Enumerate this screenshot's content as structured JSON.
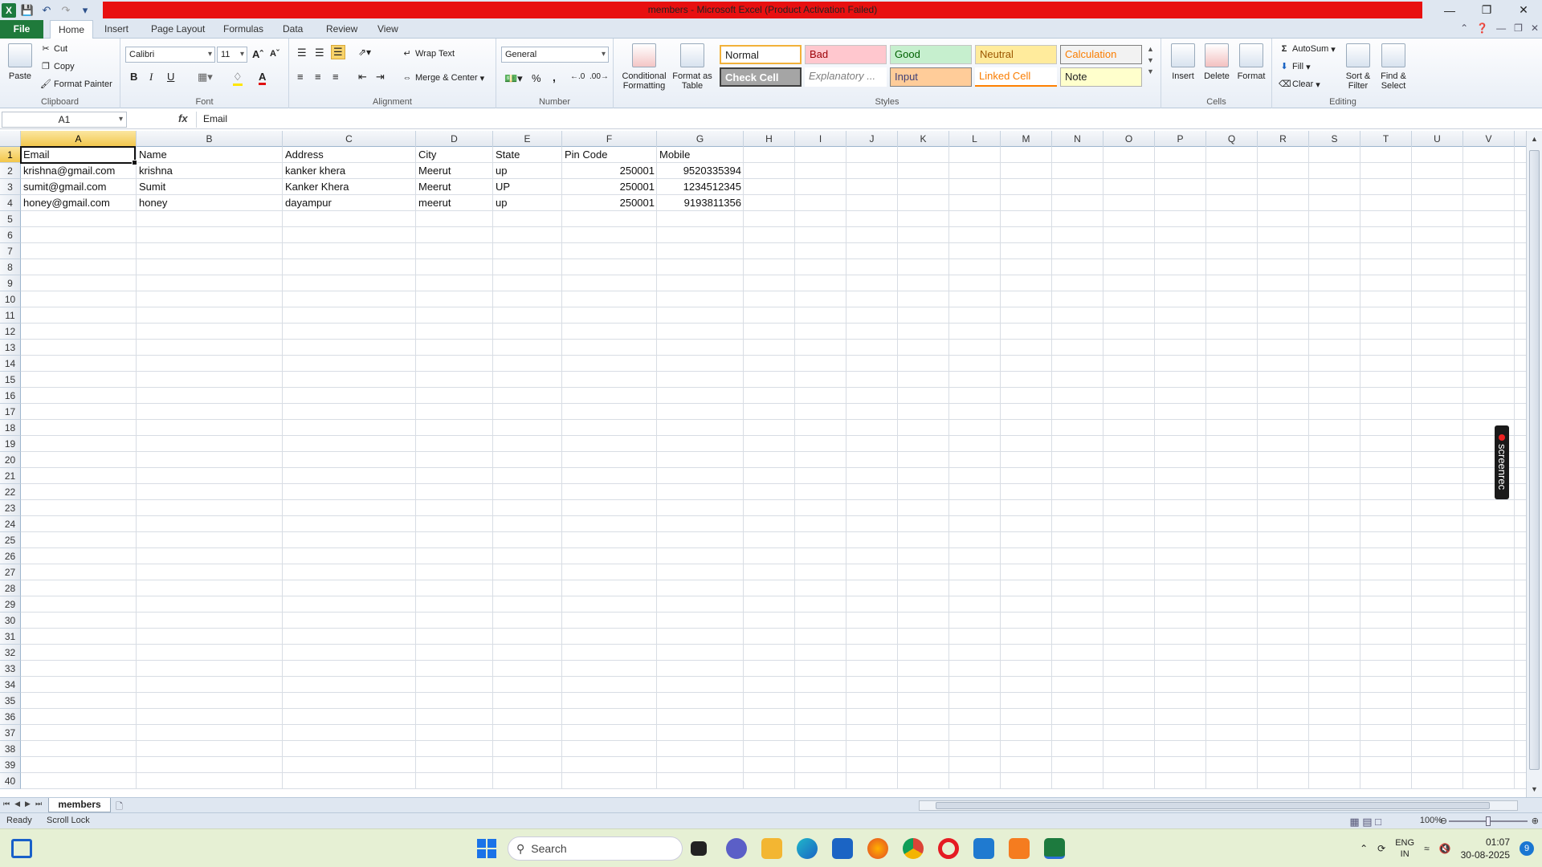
{
  "window": {
    "title": "members - Microsoft Excel (Product Activation Failed)"
  },
  "tabs": {
    "file": "File",
    "home": "Home",
    "insert": "Insert",
    "page_layout": "Page Layout",
    "formulas": "Formulas",
    "data": "Data",
    "review": "Review",
    "view": "View"
  },
  "ribbon": {
    "clipboard": {
      "label": "Clipboard",
      "paste": "Paste",
      "cut": "Cut",
      "copy": "Copy",
      "format_painter": "Format Painter"
    },
    "font": {
      "label": "Font",
      "name": "Calibri",
      "size": "11",
      "bold": "B",
      "italic": "I",
      "underline": "U"
    },
    "alignment": {
      "label": "Alignment",
      "wrap_text": "Wrap Text",
      "merge_center": "Merge & Center"
    },
    "number": {
      "label": "Number",
      "format": "General",
      "percent": "%",
      "comma": ","
    },
    "styles": {
      "label": "Styles",
      "conditional_formatting": "Conditional Formatting",
      "format_as_table": "Format as Table",
      "items": [
        "Normal",
        "Bad",
        "Good",
        "Neutral",
        "Calculation",
        "Check Cell",
        "Explanatory ...",
        "Input",
        "Linked Cell",
        "Note"
      ]
    },
    "cells": {
      "label": "Cells",
      "insert": "Insert",
      "delete": "Delete",
      "format": "Format"
    },
    "editing": {
      "label": "Editing",
      "autosum": "AutoSum",
      "fill": "Fill",
      "clear": "Clear",
      "sort_filter": "Sort & Filter",
      "find_select": "Find & Select"
    }
  },
  "formula_bar": {
    "name_box": "A1",
    "fx": "fx",
    "content": "Email"
  },
  "sheet": {
    "columns": [
      "A",
      "B",
      "C",
      "D",
      "E",
      "F",
      "G",
      "H",
      "I",
      "J",
      "K",
      "L",
      "M",
      "N",
      "O",
      "P",
      "Q",
      "R",
      "S",
      "T",
      "U",
      "V"
    ],
    "rows": [
      "1",
      "2",
      "3",
      "4",
      "5",
      "6",
      "7",
      "8",
      "9",
      "10",
      "11",
      "12",
      "13",
      "14",
      "15",
      "16",
      "17",
      "18",
      "19",
      "20",
      "21",
      "22",
      "23",
      "24",
      "25",
      "26",
      "27",
      "28",
      "29",
      "30",
      "31",
      "32",
      "33",
      "34",
      "35",
      "36",
      "37",
      "38",
      "39",
      "40"
    ],
    "data": [
      [
        "Email",
        "Name",
        "Address",
        "City",
        "State",
        "Pin Code",
        "Mobile"
      ],
      [
        "krishna@gmail.com",
        "krishna",
        "kanker khera",
        "Meerut",
        "up",
        "250001",
        "9520335394"
      ],
      [
        "sumit@gmail.com",
        "Sumit",
        "Kanker Khera",
        "Meerut",
        "UP",
        "250001",
        "1234512345"
      ],
      [
        "honey@gmail.com",
        "honey",
        "dayampur",
        "meerut",
        "up",
        "250001",
        "9193811356"
      ]
    ]
  },
  "sheet_tabs": {
    "active": "members"
  },
  "overlay": {
    "screenrec": "screenrec"
  },
  "status": {
    "ready": "Ready",
    "scroll_lock": "Scroll Lock",
    "zoom": "100%"
  },
  "taskbar": {
    "search_placeholder": "Search",
    "lang_1": "ENG",
    "lang_2": "IN",
    "time": "01:07",
    "date": "30-08-2025",
    "notifications": "9"
  }
}
